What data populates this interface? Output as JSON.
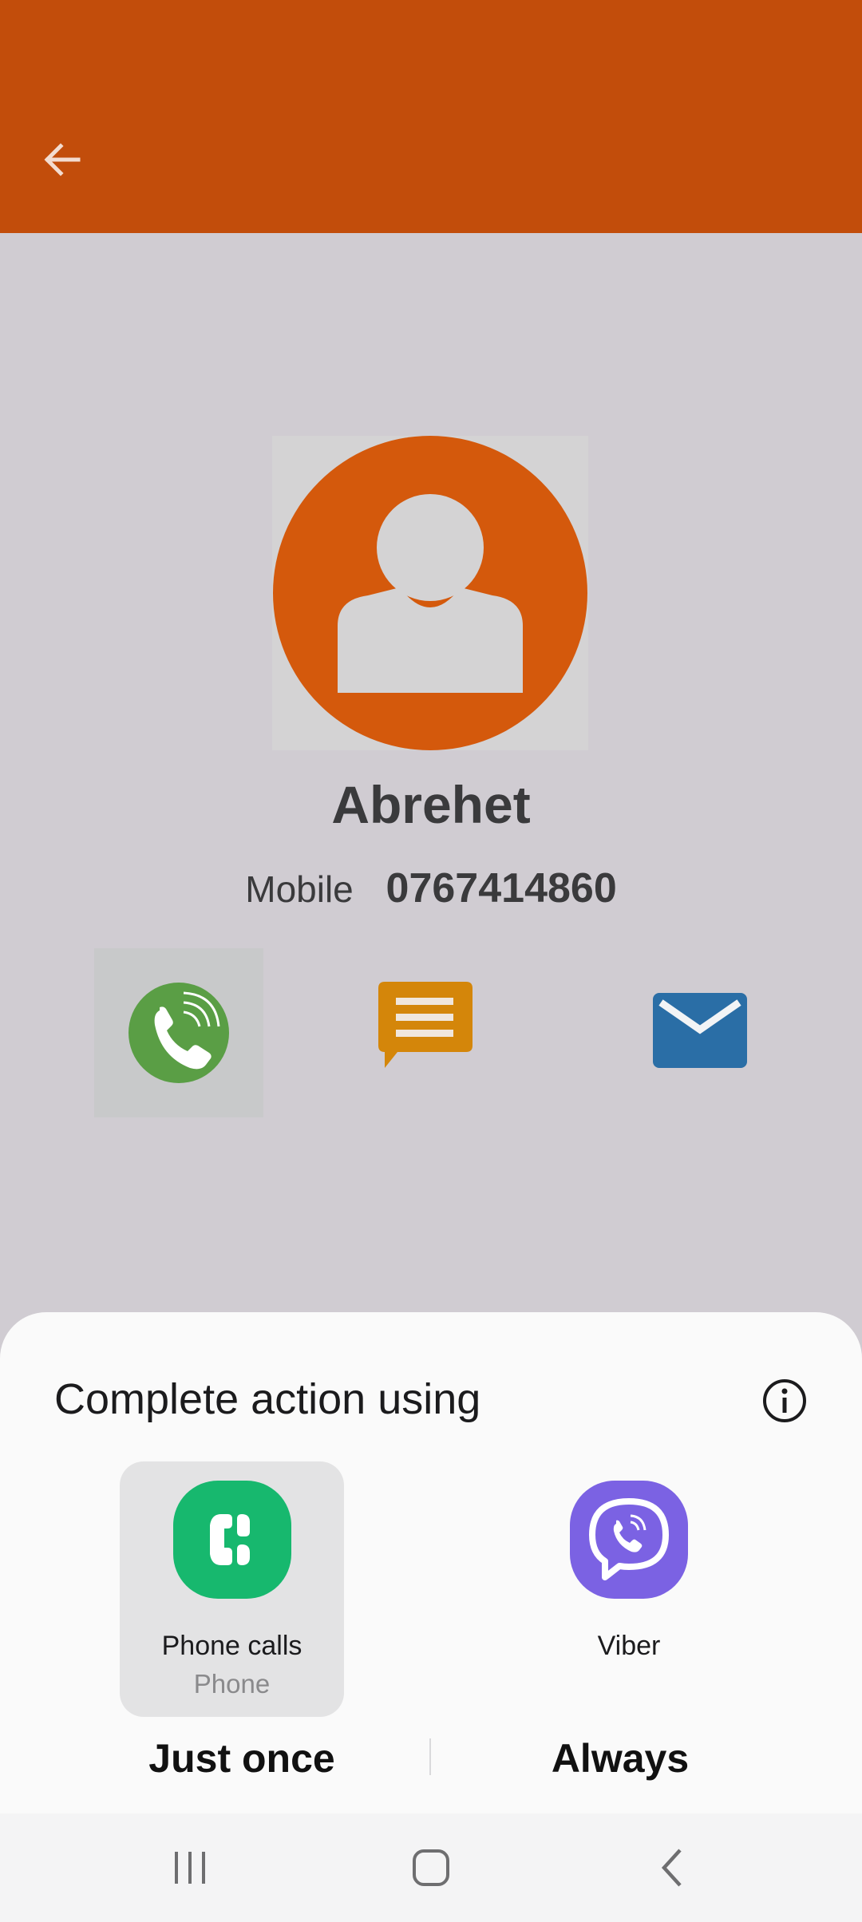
{
  "header": {
    "background": "#c24d0b",
    "back_icon": "arrow-left-icon"
  },
  "contact": {
    "name": "Abrehet",
    "phone_label": "Mobile",
    "phone_number": "0767414860",
    "avatar_icon": "person-avatar-icon",
    "avatar_color": "#d4590c"
  },
  "actions": [
    {
      "icon": "phone-call-icon",
      "color": "#5a9e45"
    },
    {
      "icon": "message-icon",
      "color": "#d4860a"
    },
    {
      "icon": "email-icon",
      "color": "#2a6ea6"
    }
  ],
  "sheet": {
    "title": "Complete action using",
    "info_icon": "info-icon",
    "apps": [
      {
        "label": "Phone calls",
        "sublabel": "Phone",
        "icon": "phone-app-icon",
        "color": "#17b86e",
        "selected": true
      },
      {
        "label": "Viber",
        "icon": "viber-icon",
        "color": "#7b62e3",
        "selected": false
      }
    ],
    "buttons": {
      "just_once": "Just once",
      "always": "Always"
    }
  },
  "navbar": {
    "recents_icon": "recents-icon",
    "home_icon": "home-icon",
    "back_icon": "back-icon"
  }
}
